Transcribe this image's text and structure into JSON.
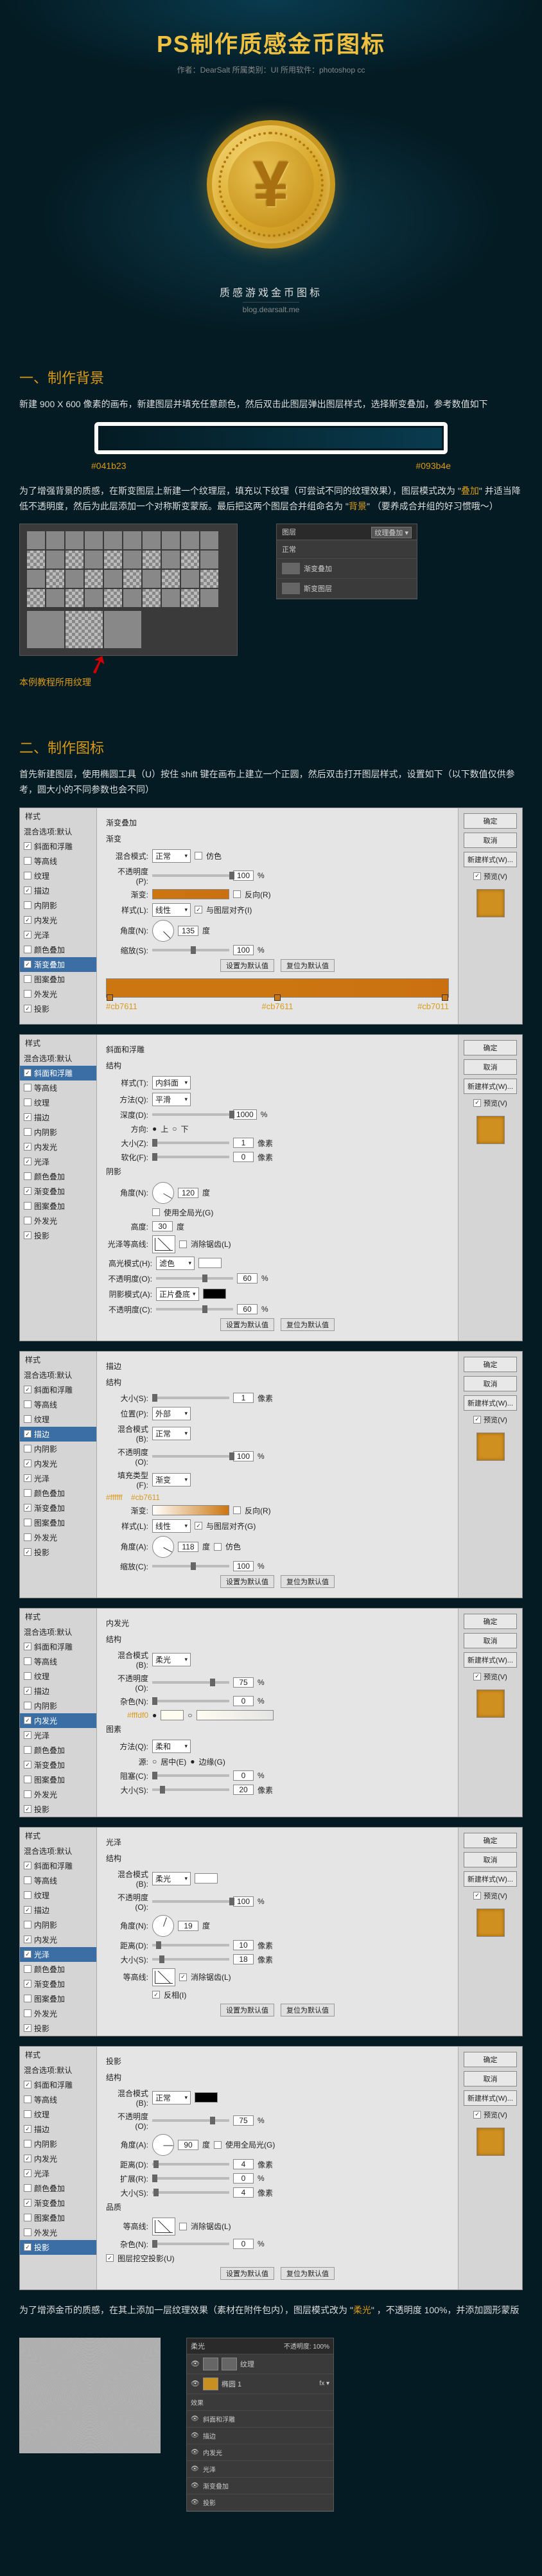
{
  "header": {
    "title": "PS制作质感金币图标",
    "subtitle": "作者：DearSalt  所属类别：UI  所用软件：photoshop cc"
  },
  "coin": {
    "symbol": "¥",
    "caption": "质感游戏金币图标",
    "url": "blog.dearsalt.me"
  },
  "sec1": {
    "title": "一、制作背景",
    "p1": "新建 900 X 600 像素的画布，新建图层并填充任意颜色，然后双击此图层弹出图层样式，选择斯变叠加，参考数值如下",
    "grad_left": "#041b23",
    "grad_right": "#093b4e",
    "p2_a": "为了增强背景的质感，在斯变图层上新建一个纹理层，填充以下纹理（可尝试不同的纹理效果），图层模式改为 \"",
    "p2_hl1": "叠加",
    "p2_b": "\" 并适当降低不透明度，然后为此层添加一个对称斯变蒙版。最后把这两个图层合并组命名为 \"",
    "p2_hl2": "背景",
    "p2_c": "\" （要养成合并组的好习惯哦～）",
    "tex_label": "本例教程所用纹理",
    "mini": {
      "hdr": "图层",
      "grad_btn": "纹理叠加 ▾",
      "normal": "正常",
      "row1": "渐变叠加",
      "row2": "斯变图层"
    }
  },
  "sec2": {
    "title": "二、制作图标",
    "p1": "首先新建图层，使用椭圆工具（U）按住 shift 键在画布上建立一个正圆，然后双击打开图层样式，设置如下（以下数值仅供参考，圆大小的不同参数也会不同）"
  },
  "ls_right": {
    "ok": "确定",
    "cancel": "取消",
    "new": "新建样式(W)...",
    "preview": "预览(V)"
  },
  "ls_styles": {
    "hdr": "样式",
    "blend": "混合选项:默认",
    "bevel": "斜面和浮雕",
    "contour": "等高线",
    "texture": "纹理",
    "stroke": "描边",
    "innerShadow": "内阴影",
    "innerGlow": "内发光",
    "satin": "光泽",
    "colorOverlay": "颜色叠加",
    "gradientOverlay": "渐变叠加",
    "patternOverlay": "图案叠加",
    "outerGlow": "外发光",
    "dropShadow": "投影"
  },
  "panel1": {
    "title": "渐变叠加",
    "sub": "渐变",
    "blendMode": "混合模式:",
    "blendMode_v": "正常",
    "dither": "仿色",
    "opacity": "不透明度(P):",
    "opacity_v": "100",
    "pct": "%",
    "gradient": "渐变:",
    "reverse": "反向(R)",
    "style": "样式(L):",
    "style_v": "线性",
    "align": "与图层对齐(I)",
    "angle": "角度(N):",
    "angle_v": "135",
    "deg": "度",
    "scale": "缩放(S):",
    "scale_v": "100",
    "reset": "设置为默认值",
    "restore": "复位为默认值",
    "stops": [
      "#cb7611",
      "#cb7611",
      "#cb7011"
    ]
  },
  "panel2": {
    "title": "斜面和浮雕",
    "sub": "结构",
    "style": "样式(T):",
    "style_v": "内斜面",
    "tech": "方法(Q):",
    "tech_v": "平滑",
    "depth": "深度(D):",
    "depth_v": "1000",
    "dir": "方向:",
    "up": "上",
    "down": "下",
    "size": "大小(Z):",
    "size_v": "1",
    "px": "像素",
    "soft": "软化(F):",
    "soft_v": "0",
    "shade": "阴影",
    "angle": "角度(N):",
    "angle_v": "120",
    "useGlobal": "使用全局光(G)",
    "alt": "高度:",
    "alt_v": "30",
    "gloss": "光泽等高线:",
    "aa": "消除锯齿(L)",
    "hlMode": "高光模式(H):",
    "hlMode_v": "滤色",
    "hlOp": "不透明度(O):",
    "hlOp_v": "60",
    "shMode": "阴影模式(A):",
    "shMode_v": "正片叠底",
    "shOp": "不透明度(C):",
    "shOp_v": "60",
    "reset": "设置为默认值",
    "restore": "复位为默认值"
  },
  "panel3": {
    "title": "描边",
    "sub": "结构",
    "size": "大小(S):",
    "size_v": "1",
    "px": "像素",
    "pos": "位置(P):",
    "pos_v": "外部",
    "blend": "混合模式(B):",
    "blend_v": "正常",
    "op": "不透明度(O):",
    "op_v": "100",
    "fillType": "填充类型(F):",
    "fillType_v": "渐变",
    "grad": "渐变:",
    "stops": [
      "#ffffff",
      "#cb7611"
    ],
    "reverse": "反向(R)",
    "style": "样式(L):",
    "style_v": "线性",
    "align": "与图层对齐(G)",
    "angle": "角度(A):",
    "angle_v": "118",
    "deg": "度",
    "dither": "仿色",
    "scale": "缩放(C):",
    "scale_v": "100",
    "reset": "设置为默认值",
    "restore": "复位为默认值",
    "c1": "#ffffff",
    "c2": "#cb7611"
  },
  "panel4": {
    "title": "内发光",
    "sub": "结构",
    "blend": "混合模式(B):",
    "blend_v": "柔光",
    "op": "不透明度(O):",
    "op_v": "75",
    "noise": "杂色(N):",
    "noise_v": "0",
    "color_hex": "#fffdf0",
    "elem": "图素",
    "tech": "方法(Q):",
    "tech_v": "柔和",
    "src": "源:",
    "center": "居中(E)",
    "edge": "边缘(G)",
    "choke": "阻塞(C):",
    "choke_v": "0",
    "size": "大小(S):",
    "size_v": "20",
    "px": "像素"
  },
  "panel5": {
    "title": "光泽",
    "sub": "结构",
    "blend": "混合模式(B):",
    "blend_v": "柔光",
    "op": "不透明度(O):",
    "op_v": "100",
    "angle": "角度(N):",
    "angle_v": "19",
    "deg": "度",
    "dist": "距离(D):",
    "dist_v": "10",
    "px": "像素",
    "size": "大小(S):",
    "size_v": "18",
    "contour": "等高线:",
    "aa": "消除锯齿(L)",
    "invert": "反相(I)",
    "reset": "设置为默认值",
    "restore": "复位为默认值"
  },
  "panel6": {
    "title": "投影",
    "sub": "结构",
    "blend": "混合模式(B):",
    "blend_v": "正常",
    "op": "不透明度(O):",
    "op_v": "75",
    "angle": "角度(A):",
    "angle_v": "90",
    "deg": "度",
    "useGlobal": "使用全局光(G)",
    "dist": "距离(D):",
    "dist_v": "4",
    "px": "像素",
    "spread": "扩展(R):",
    "spread_v": "0",
    "size": "大小(S):",
    "size_v": "4",
    "q": "品质",
    "contour": "等高线:",
    "aa": "消除锯齿(L)",
    "noise": "杂色(N):",
    "noise_v": "0",
    "knock": "图层挖空投影(U)",
    "reset": "设置为默认值",
    "restore": "复位为默认值"
  },
  "after": {
    "p1_a": "为了增添金币的质感，在其上添加一层纹理效果（素材在附件包内），图层模式改为 \"",
    "p1_hl": "柔光",
    "p1_b": "\" ，不透明度 100%，并添加圆形蒙版",
    "layers": {
      "top_mode": "柔光",
      "top_op": "不透明度: 100%",
      "row_tex": "纹理",
      "row_fx": "fx ▾",
      "row_ellipse": "椭圆 1",
      "fx_title": "效果",
      "fx1": "斜面和浮雕",
      "fx2": "描边",
      "fx3": "内发光",
      "fx4": "光泽",
      "fx5": "渐变叠加",
      "fx6": "投影"
    }
  }
}
